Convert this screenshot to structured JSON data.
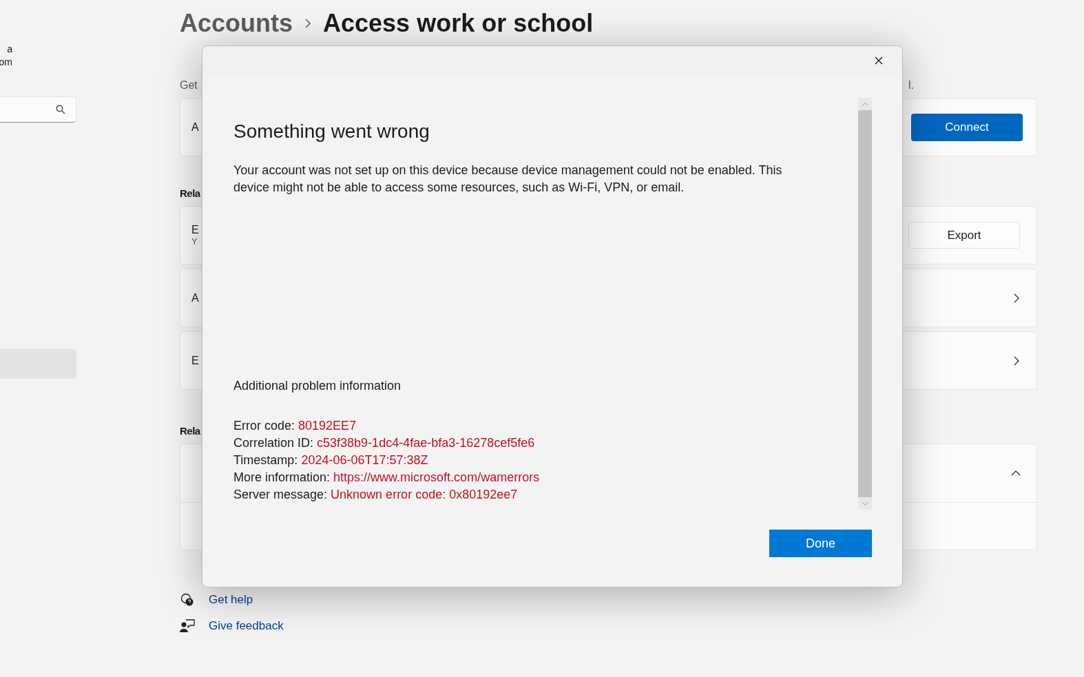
{
  "sidebar": {
    "user_lines": [
      "a",
      "om"
    ],
    "nav_items": [
      {
        "selected": true
      }
    ]
  },
  "breadcrumb": [
    "Accounts",
    "Access work or school"
  ],
  "intro": {
    "start": "Get",
    "end": "l."
  },
  "connect_card": {
    "label": "A",
    "button": "Connect"
  },
  "sections": [
    {
      "header": "Rela",
      "cards": [
        {
          "kind": "button",
          "title": "E",
          "subtitle": "Y",
          "button": "Export"
        },
        {
          "kind": "link",
          "title": "A"
        },
        {
          "kind": "link",
          "title": "E"
        }
      ]
    },
    {
      "header": "Rela",
      "cards": [
        {
          "kind": "expander",
          "expanded": true
        }
      ]
    }
  ],
  "footer_links": [
    "Get help",
    "Give feedback"
  ],
  "dialog": {
    "title": "Something went wrong",
    "message": "Your account was not set up on this device because device management could not be enabled. This device might not be able to access some resources, such as Wi-Fi, VPN, or email.",
    "details_header": "Additional problem information",
    "details": [
      {
        "label": "Error code:",
        "value": "80192EE7"
      },
      {
        "label": "Correlation ID:",
        "value": "c53f38b9-1dc4-4fae-bfa3-16278cef5fe6"
      },
      {
        "label": "Timestamp:",
        "value": "2024-06-06T17:57:38Z"
      },
      {
        "label": "More information:",
        "value": "https://www.microsoft.com/wamerrors"
      },
      {
        "label": "Server message:",
        "value": "Unknown error code: 0x80192ee7"
      }
    ],
    "button": "Done"
  }
}
